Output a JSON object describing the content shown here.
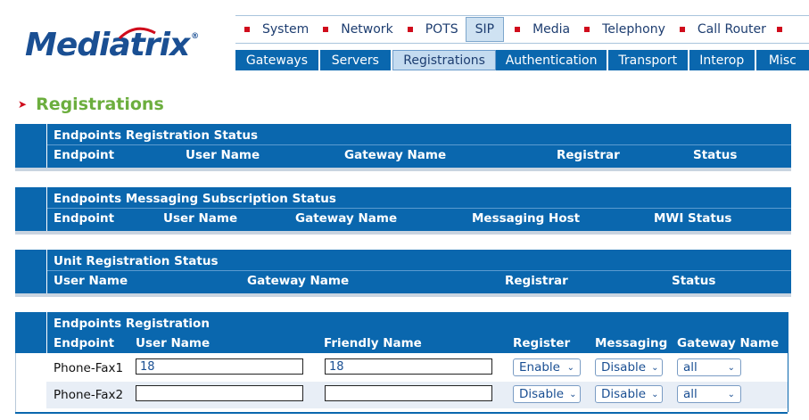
{
  "brand": {
    "name": "Mediatrix",
    "mark": "®"
  },
  "top_nav": [
    "System",
    "Network",
    "POTS",
    "SIP",
    "Media",
    "Telephony",
    "Call Router"
  ],
  "top_nav_active": "SIP",
  "sub_nav": [
    "Gateways",
    "Servers",
    "Registrations",
    "Authentication",
    "Transport",
    "Interop",
    "Misc"
  ],
  "sub_nav_active": "Registrations",
  "page_title": "Registrations",
  "panels": {
    "endpoints_status": {
      "title": "Endpoints Registration Status",
      "headers": [
        "Endpoint",
        "User Name",
        "Gateway Name",
        "Registrar",
        "Status"
      ]
    },
    "messaging_status": {
      "title": "Endpoints Messaging Subscription Status",
      "headers": [
        "Endpoint",
        "User Name",
        "Gateway Name",
        "Messaging Host",
        "MWI Status"
      ]
    },
    "unit_status": {
      "title": "Unit Registration Status",
      "headers": [
        "User Name",
        "Gateway Name",
        "Registrar",
        "Status"
      ]
    }
  },
  "endpoints_registration": {
    "title": "Endpoints Registration",
    "headers": [
      "Endpoint",
      "User Name",
      "Friendly Name",
      "Register",
      "Messaging",
      "Gateway Name"
    ],
    "rows": [
      {
        "endpoint": "Phone-Fax1",
        "user_name": "18",
        "friendly_name": "18",
        "register": "Enable",
        "messaging": "Disable",
        "gateway": "all"
      },
      {
        "endpoint": "Phone-Fax2",
        "user_name": "",
        "friendly_name": "",
        "register": "Disable",
        "messaging": "Disable",
        "gateway": "all"
      }
    ]
  },
  "colors": {
    "nav_blue": "#0a67ae",
    "title_green": "#6cae3e",
    "accent_red": "#d00c1c"
  }
}
